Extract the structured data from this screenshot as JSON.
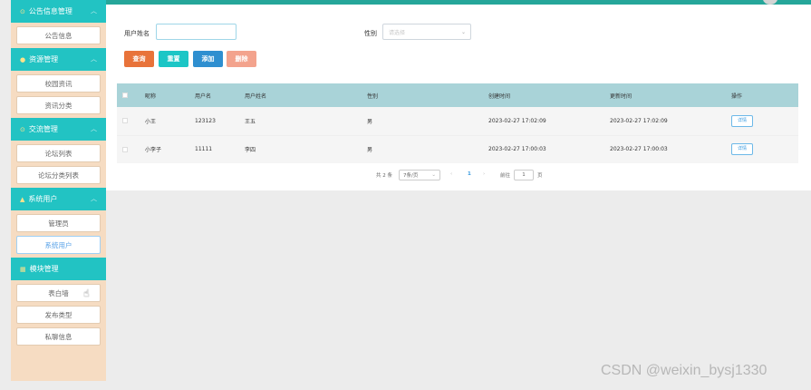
{
  "sidebar": {
    "groups": [
      {
        "label": "公告信息管理",
        "items": [
          "公告信息"
        ]
      },
      {
        "label": "资源管理",
        "items": [
          "校园资讯",
          "资讯分类"
        ]
      },
      {
        "label": "交流管理",
        "items": [
          "论坛列表",
          "论坛分类列表"
        ]
      },
      {
        "label": "系统用户",
        "items": [
          "管理员",
          "系统用户"
        ]
      },
      {
        "label": "模块管理",
        "items": [
          "表白墙",
          "发布类型",
          "私聊信息"
        ]
      }
    ]
  },
  "search": {
    "name_label": "用户姓名",
    "name_value": "",
    "gender_label": "性别",
    "gender_placeholder": "请选择"
  },
  "buttons": {
    "query": "查询",
    "reset": "重置",
    "add": "添加",
    "delete": "删除"
  },
  "table": {
    "headers": [
      "昵称",
      "用户名",
      "用户姓名",
      "性别",
      "创建时间",
      "更新时间",
      "操作"
    ],
    "rows": [
      {
        "nickname": "小王",
        "username": "123123",
        "realname": "王五",
        "gender": "男",
        "created": "2023-02-27 17:02:09",
        "updated": "2023-02-27 17:02:09",
        "action": "详情"
      },
      {
        "nickname": "小李子",
        "username": "11111",
        "realname": "李四",
        "gender": "男",
        "created": "2023-02-27 17:00:03",
        "updated": "2023-02-27 17:00:03",
        "action": "详情"
      }
    ]
  },
  "pagination": {
    "total_text": "共 2 条",
    "page_size": "7条/页",
    "prev": "‹",
    "current": "1",
    "next": "›",
    "goto_label": "前往",
    "goto_value": "1",
    "page_suffix": "页"
  },
  "watermark": "CSDN @weixin_bysj1330",
  "colors": {
    "sidebar_group": "#22c3c3",
    "sidebar_bg": "#f6dcc2",
    "table_header": "#a9d3d8",
    "query": "#e8733a",
    "reset": "#1cc6c6",
    "add": "#2f8fd0",
    "delete": "#f3a38d"
  }
}
